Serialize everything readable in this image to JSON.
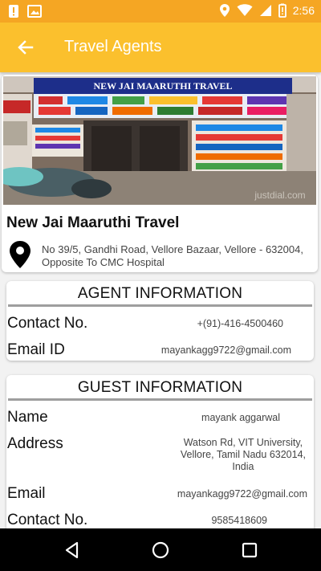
{
  "status_bar": {
    "time": "2:56"
  },
  "app_bar": {
    "title": "Travel Agents"
  },
  "agent": {
    "name": "New Jai Maaruthi Travel",
    "address": "No 39/5, Gandhi Road, Vellore Bazaar, Vellore - 632004, Opposite To CMC Hospital",
    "sign_text": "NEW JAI MAARUTHI TRAVEL",
    "watermark": "justdial.com"
  },
  "agent_info": {
    "heading": "AGENT INFORMATION",
    "rows": [
      {
        "label": "Contact No.",
        "value": "+(91)-416-4500460"
      },
      {
        "label": "Email ID",
        "value": "mayankagg9722@gmail.com"
      }
    ]
  },
  "guest_info": {
    "heading": "GUEST INFORMATION",
    "rows": [
      {
        "label": "Name",
        "value": "mayank aggarwal"
      },
      {
        "label": "Address",
        "value": "Watson Rd, VIT University,\nVellore, Tamil Nadu 632014,\nIndia"
      },
      {
        "label": "Email",
        "value": "mayankagg9722@gmail.com"
      },
      {
        "label": "Contact No.",
        "value": "9585418609"
      }
    ]
  },
  "colors": {
    "status_bar": "#f5a623",
    "app_bar": "#fbc02d",
    "nav_bar": "#000000"
  }
}
